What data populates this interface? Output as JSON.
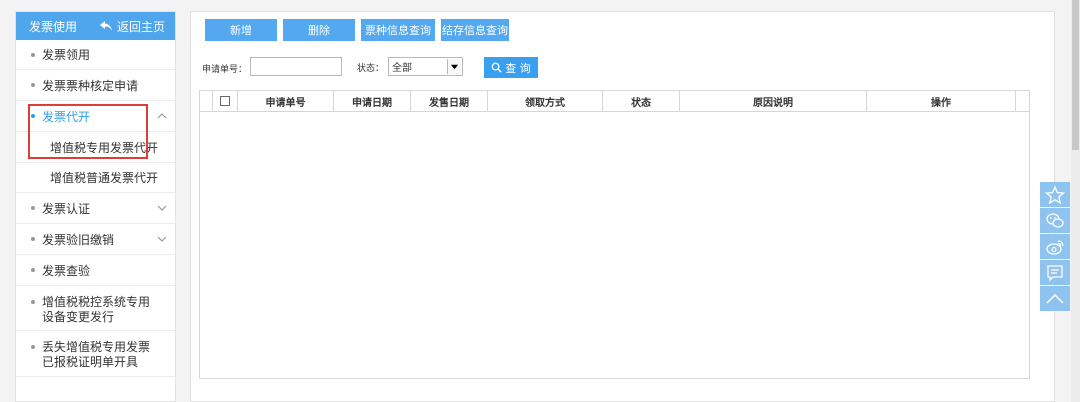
{
  "sidebar": {
    "title": "发票使用",
    "back_label": "返回主页",
    "items": [
      {
        "label": "发票领用"
      },
      {
        "label": "发票票种核定申请"
      },
      {
        "label": "发票代开"
      },
      {
        "label": "增值税专用发票代开"
      },
      {
        "label": "增值税普通发票代开"
      },
      {
        "label": "发票认证"
      },
      {
        "label": "发票验旧缴销"
      },
      {
        "label": "发票查验"
      },
      {
        "label": "增值税税控系统专用设备变更发行"
      },
      {
        "label": "丢失增值税专用发票已报税证明单开具"
      }
    ]
  },
  "toolbar": {
    "add_label": "新增",
    "delete_label": "删除",
    "ticket_query_label": "票种信息查询",
    "stock_query_label": "结存信息查询"
  },
  "search": {
    "app_no_label": "申请单号：",
    "app_no_value": "",
    "status_label": "状态：",
    "status_value": "全部",
    "query_label": "查 询"
  },
  "table": {
    "headers": [
      "申请单号",
      "申请日期",
      "发售日期",
      "领取方式",
      "状态",
      "原因说明",
      "操作"
    ]
  },
  "colors": {
    "accent": "#4fa6ec",
    "active_text": "#2e9fe8",
    "highlight_border": "#e03c3c",
    "float_tool_bg": "#8fc3ef"
  },
  "icons": {
    "back": "back-arrow-icon",
    "favorite": "star-icon",
    "wechat": "wechat-icon",
    "weibo": "weibo-icon",
    "feedback": "message-icon",
    "top": "chevron-up-icon",
    "search": "search-icon"
  }
}
